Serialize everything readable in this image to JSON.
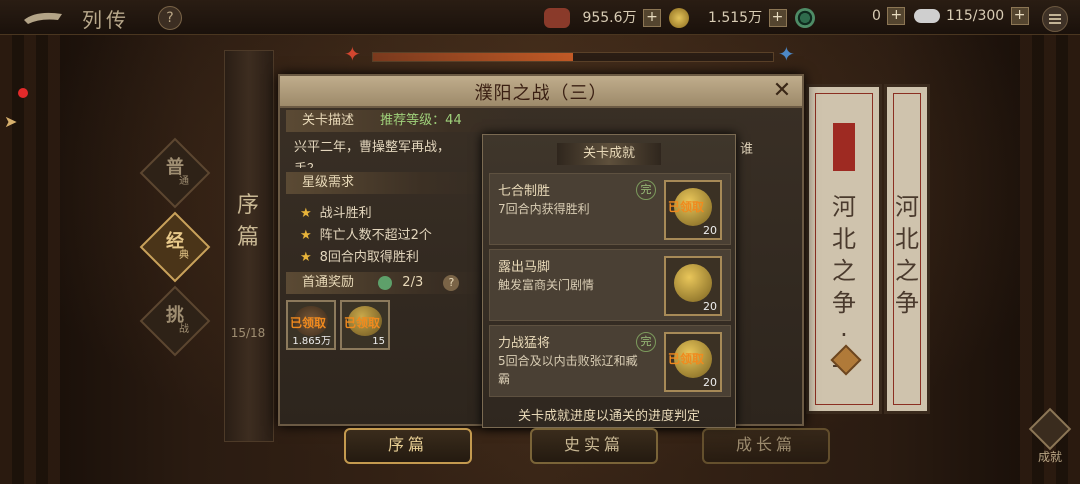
{
  "topbar": {
    "title": "列传",
    "help": "?",
    "resources": [
      {
        "value": "955.6万",
        "plus": "+"
      },
      {
        "value": "1.515万",
        "plus": "+"
      },
      {
        "value": "0",
        "plus": "+"
      },
      {
        "value": "115/300",
        "plus": "+"
      }
    ]
  },
  "side_tabs": [
    {
      "label": "普",
      "sub": "通"
    },
    {
      "label": "经",
      "sub": "典"
    },
    {
      "label": "挑",
      "sub": "战"
    }
  ],
  "scroll": {
    "title": "序篇",
    "count": "15/18"
  },
  "panel": {
    "title": "濮阳之战（三）",
    "close": "✕",
    "desc_label": "关卡描述",
    "recommend_label": "推荐等级：",
    "recommend_level": "44",
    "description": "兴平二年，曹操整军再战，",
    "description_tail": "谁",
    "description_line2": "手？",
    "star_label": "星级需求",
    "conditions": [
      "战斗胜利",
      "阵亡人数不超过2个",
      "8回合内取得胜利"
    ],
    "first_reward_label": "首通奖励",
    "first_reward_progress": "2/3",
    "rewards": [
      {
        "stamp": "已领取",
        "num": "1.865万"
      },
      {
        "stamp": "已领取",
        "num": "15"
      }
    ]
  },
  "achievements": {
    "title": "关卡成就",
    "items": [
      {
        "name": "七合制胜",
        "desc": "7回合内获得胜利",
        "done": "完",
        "stamp": "已领取",
        "num": "20"
      },
      {
        "name": "露出马脚",
        "desc": "触发富商关门剧情",
        "done": "",
        "stamp": "",
        "num": "20"
      },
      {
        "name": "力战猛将",
        "desc": "5回合及以内击败张辽和臧霸",
        "done": "完",
        "stamp": "已领取",
        "num": "20"
      }
    ],
    "footer": "关卡成就进度以通关的进度判定"
  },
  "right_scrolls": [
    {
      "seal": "",
      "text": "河北之争·一"
    },
    {
      "seal": "",
      "text": "河北之争"
    }
  ],
  "bottom": {
    "buttons": [
      "序篇",
      "史实篇",
      "成长篇"
    ],
    "achieve_label": "成就"
  },
  "progress_fraction": 0.5
}
